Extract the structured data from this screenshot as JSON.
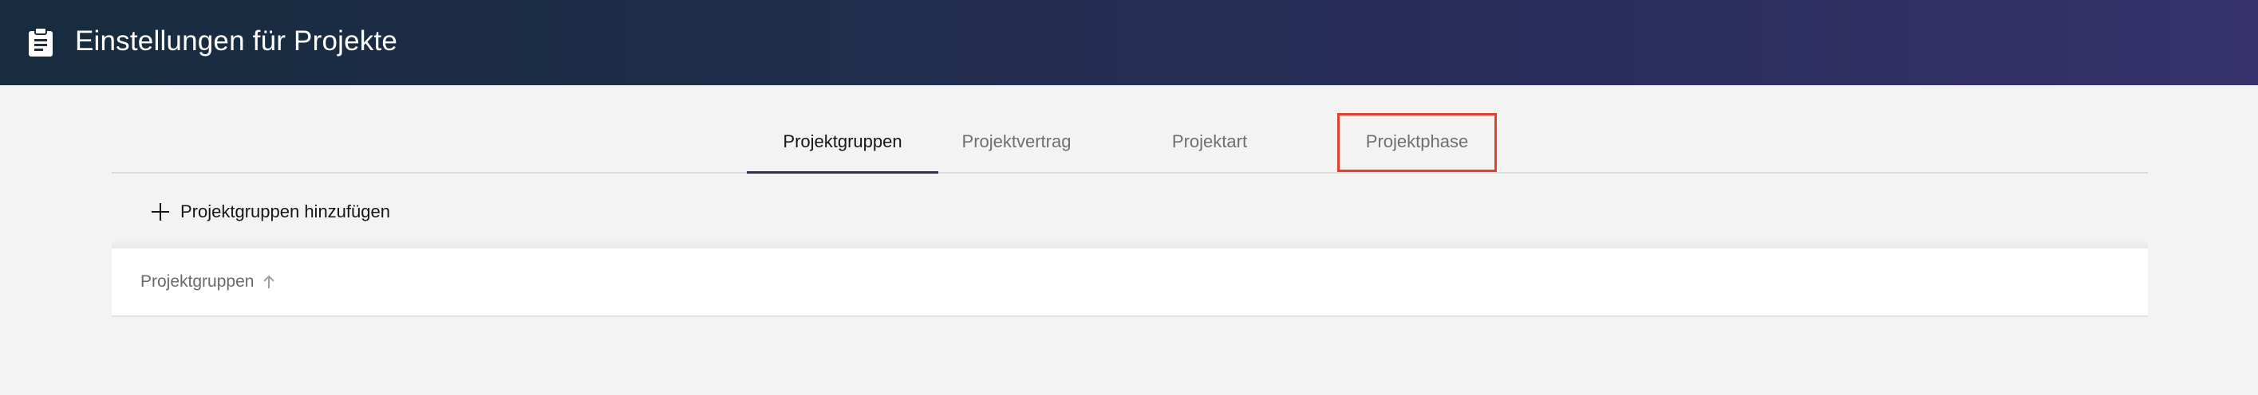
{
  "header": {
    "title": "Einstellungen für Projekte",
    "icon": "clipboard-icon",
    "gradient": [
      "#172c3e",
      "#37326d"
    ]
  },
  "tabs": [
    {
      "label": "Projektgruppen",
      "active": true
    },
    {
      "label": "Projektvertrag",
      "active": false
    },
    {
      "label": "Projektart",
      "active": false
    },
    {
      "label": "Projektphase",
      "active": false,
      "highlighted": true
    }
  ],
  "toolbar": {
    "add_label": "Projektgruppen hinzufügen",
    "add_icon": "plus-icon"
  },
  "table": {
    "columns": [
      {
        "label": "Projektgruppen",
        "sort": "ascending",
        "sort_icon": "arrow-up-icon"
      }
    ]
  },
  "colors": {
    "highlight_border": "#e2402b",
    "active_tab_underline": "#2f2f55",
    "background": "#f3f3f3"
  }
}
